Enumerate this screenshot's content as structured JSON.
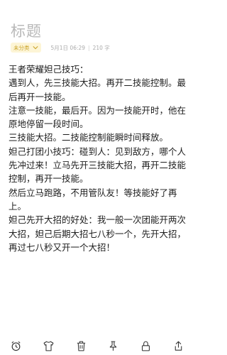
{
  "note": {
    "title": "标题",
    "folder": "未分类",
    "date": "5月1日 06:29",
    "char_count": "210 字",
    "lines": [
      "王者荣耀妲己技巧：",
      "遇到人，先三技能大招。再开二技能控制。最后再开一技能。",
      "注意一技能，最后开。因为一技能开时，他在原地停留一段时间。",
      "三技能大招。二技能控制能瞬时间释放。",
      "妲己打团小技巧：碰到人：见到敌方，哪个人先冲过来！立马先开三技能大招，再开二技能控制，再开一技能。",
      "然后立马跑路，不用管队友！等技能好了再上。",
      "妲己先开大招的好处：我一般一次团能开两次大招，妲己后期大招七八秒一个，先开大招，再过七八秒又开一个大招！"
    ]
  },
  "toolbar": {
    "icons": [
      "alarm-clock-icon",
      "tshirt-icon",
      "trash-icon",
      "pin-icon",
      "lock-icon",
      "share-icon"
    ]
  },
  "colors": {
    "folder_bg": "#fdf5d6",
    "folder_text": "#c9a227",
    "title": "#b8b8b8"
  }
}
